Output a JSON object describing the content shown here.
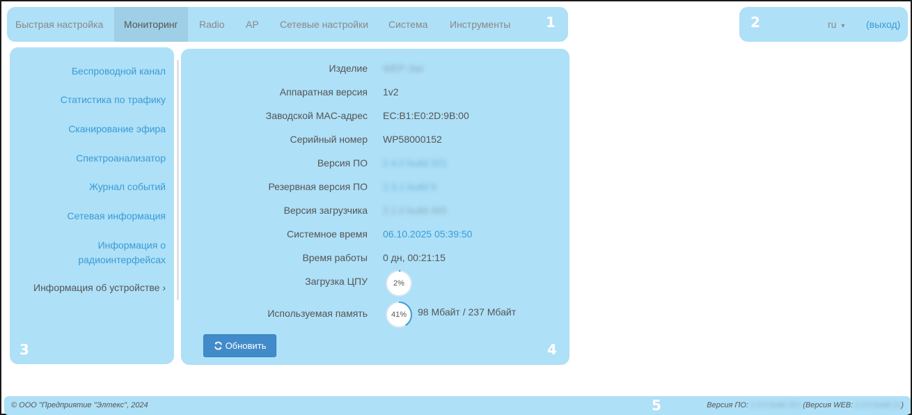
{
  "nav": {
    "items": [
      {
        "label": "Быстрая настройка"
      },
      {
        "label": "Мониторинг"
      },
      {
        "label": "Radio"
      },
      {
        "label": "AP"
      },
      {
        "label": "Сетевые настройки"
      },
      {
        "label": "Система"
      },
      {
        "label": "Инструменты"
      }
    ],
    "active_index": 1,
    "lang": "ru",
    "lang_caret": "▾",
    "logout": "(выход)"
  },
  "regions": {
    "r1": "1",
    "r2": "2",
    "r3": "3",
    "r4": "4",
    "r5": "5"
  },
  "sidebar": {
    "items": [
      {
        "label": "Беспроводной канал"
      },
      {
        "label": "Статистика по трафику"
      },
      {
        "label": "Сканирование эфира"
      },
      {
        "label": "Спектроанализатор"
      },
      {
        "label": "Журнал событий"
      },
      {
        "label": "Сетевая информация"
      },
      {
        "label": "Информация о радиоинтерфейсах"
      },
      {
        "label": "Информация об устройстве ›"
      }
    ]
  },
  "device": {
    "rows": [
      {
        "label": "Изделие",
        "value": "WEP-3ax"
      },
      {
        "label": "Аппаратная версия",
        "value": "1v2"
      },
      {
        "label": "Заводской MAC-адрес",
        "value": "EC:B1:E0:2D:9B:00"
      },
      {
        "label": "Серийный номер",
        "value": "WP58000152"
      },
      {
        "label": "Версия ПО",
        "value": "2.4.0 build 321"
      },
      {
        "label": "Резервная версия ПО",
        "value": "2.3.1 build 9"
      },
      {
        "label": "Версия загрузчика",
        "value": "2.1.0 build 465"
      },
      {
        "label": "Системное время",
        "value": "06.10.2025 05:39:50"
      },
      {
        "label": "Время работы",
        "value": "0 дн, 00:21:15"
      },
      {
        "label": "Загрузка ЦПУ",
        "value": ""
      },
      {
        "label": "Используемая память",
        "value": "98 Мбайт / 237 Мбайт"
      }
    ],
    "cpu_load": "2%",
    "cpu_fraction": 0.02,
    "mem_usage": "41%",
    "mem_fraction": 0.41,
    "refresh_label": "Обновить",
    "accent_color": "#3a9bd5"
  },
  "footer": {
    "copyright": "© ООО \"Предприятие \"Элтекс\", 2024",
    "fw_label": "Версия ПО:",
    "fw_value": "2.4.0 build 321",
    "web_label": "(Версия WEB:",
    "web_value": "2.4.0 build 21",
    "web_close": ")"
  }
}
